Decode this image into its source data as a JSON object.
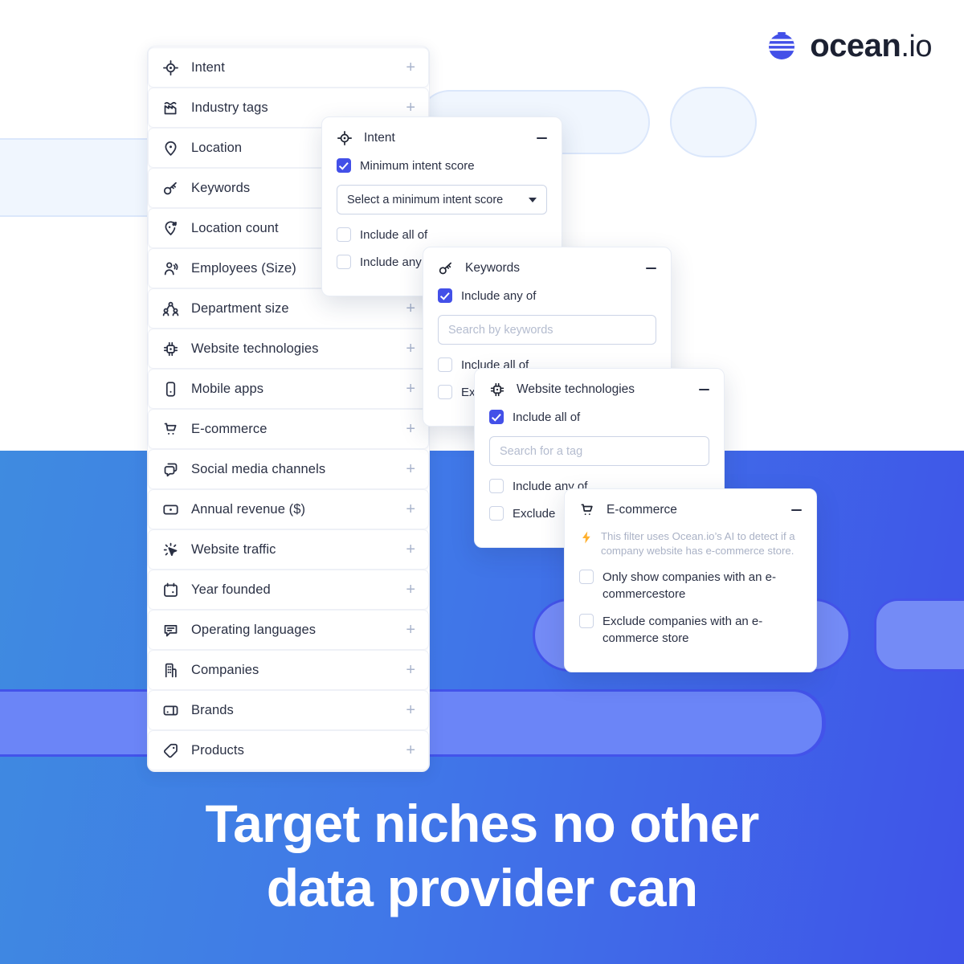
{
  "brand": {
    "logo_name": "ocean",
    "logo_suffix": ".io",
    "logo_mark_icon": "ocean-globe-icon",
    "accent_blue": "#4350e8",
    "dark_navy": "#1c2132"
  },
  "headline": {
    "line1": "Target niches no other",
    "line2": "data provider can"
  },
  "filter_list": {
    "items": [
      {
        "label": "Intent",
        "icon": "target-icon",
        "action": "+"
      },
      {
        "label": "Industry tags",
        "icon": "factory-icon",
        "action": "+"
      },
      {
        "label": "Location",
        "icon": "map-pin-icon",
        "action": "+"
      },
      {
        "label": "Keywords",
        "icon": "key-icon",
        "action": "+"
      },
      {
        "label": "Location count",
        "icon": "pin-hash-icon",
        "action": "+"
      },
      {
        "label": "Employees (Size)",
        "icon": "person-icon",
        "action": "+"
      },
      {
        "label": "Department size",
        "icon": "people-group-icon",
        "action": "+"
      },
      {
        "label": "Website technologies",
        "icon": "chip-icon",
        "action": "+"
      },
      {
        "label": "Mobile apps",
        "icon": "mobile-phone-icon",
        "action": "+"
      },
      {
        "label": "E-commerce",
        "icon": "shopping-cart-icon",
        "action": "+"
      },
      {
        "label": "Social media channels",
        "icon": "chat-bubbles-icon",
        "action": "+"
      },
      {
        "label": "Annual revenue ($)",
        "icon": "banknote-icon",
        "action": "+"
      },
      {
        "label": "Website traffic",
        "icon": "cursor-click-icon",
        "action": "+"
      },
      {
        "label": "Year founded",
        "icon": "calendar-icon",
        "action": "+"
      },
      {
        "label": "Operating languages",
        "icon": "speech-bubble-icon",
        "action": "+"
      },
      {
        "label": "Companies",
        "icon": "building-icon",
        "action": "+"
      },
      {
        "label": "Brands",
        "icon": "brand-panel-icon",
        "action": "+"
      },
      {
        "label": "Products",
        "icon": "price-tag-icon",
        "action": "+"
      }
    ]
  },
  "panels": {
    "intent": {
      "title": "Intent",
      "icon": "target-icon",
      "collapse_action": "−",
      "checkbox_min_score_label": "Minimum intent score",
      "checkbox_min_score_checked": true,
      "select_value": "Select a minimum intent score",
      "checkbox_include_all_label": "Include all of",
      "checkbox_include_all_checked": false,
      "checkbox_include_any_label": "Include any of",
      "checkbox_include_any_checked": false
    },
    "keywords": {
      "title": "Keywords",
      "icon": "key-icon",
      "collapse_action": "−",
      "checkbox_include_any_label": "Include any of",
      "checkbox_include_any_checked": true,
      "search_placeholder": "Search by keywords",
      "checkbox_include_all_label": "Include all of",
      "checkbox_include_all_checked": false,
      "checkbox_exclude_label": "Exclude",
      "checkbox_exclude_checked": false
    },
    "website_technologies": {
      "title": "Website technologies",
      "icon": "chip-icon",
      "collapse_action": "−",
      "checkbox_include_all_label": "Include all of",
      "checkbox_include_all_checked": true,
      "search_placeholder": "Search for a tag",
      "checkbox_include_any_label": "Include any of",
      "checkbox_include_any_checked": false,
      "checkbox_exclude_label": "Exclude",
      "checkbox_exclude_checked": false
    },
    "ecommerce": {
      "title": "E-commerce",
      "icon": "shopping-cart-icon",
      "collapse_action": "−",
      "ai_note": "This filter uses Ocean.io’s AI to detect if a company website has e-commerce store.",
      "ai_note_icon": "lightning-bolt-icon",
      "checkbox_only_show_label": "Only show companies with an e-commercestore",
      "checkbox_only_show_checked": false,
      "checkbox_exclude_label": "Exclude companies with an e-commerce store",
      "checkbox_exclude_checked": false
    }
  }
}
